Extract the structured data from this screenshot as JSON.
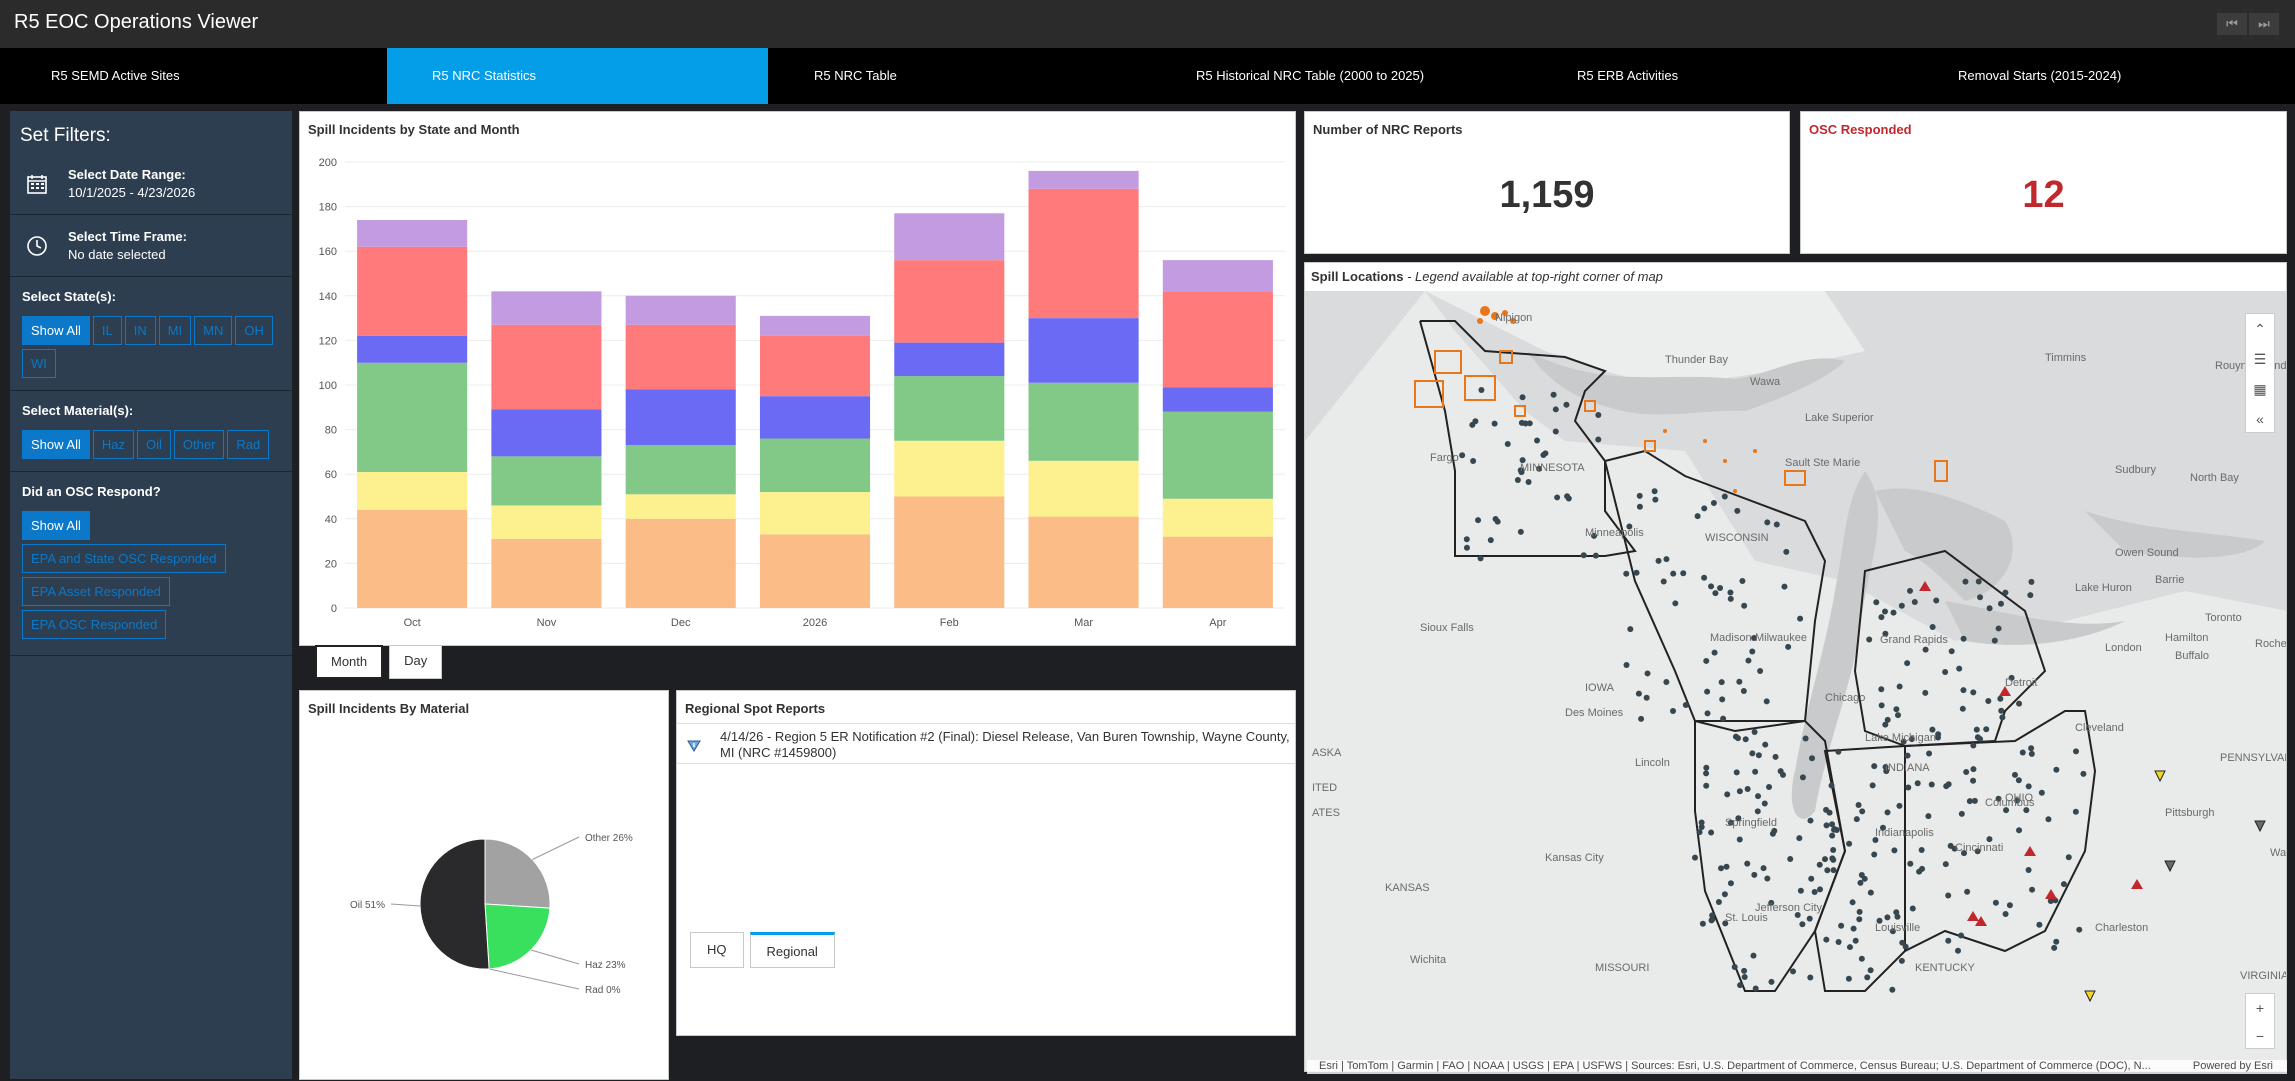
{
  "app": {
    "title": "R5 EOC Operations Viewer",
    "nav_prev_icon": "⏮",
    "nav_next_icon": "⏭"
  },
  "tabs": [
    {
      "label": "R5 SEMD Active Sites"
    },
    {
      "label": "R5 NRC Statistics"
    },
    {
      "label": "R5 NRC Table"
    },
    {
      "label": "R5 Historical NRC Table (2000 to 2025)"
    },
    {
      "label": "R5 ERB Activities"
    },
    {
      "label": "Removal Starts (2015-2024)"
    }
  ],
  "filters": {
    "title": "Set Filters:",
    "date_range_label": "Select Date Range:",
    "date_range_value": "10/1/2025 - 4/23/2026",
    "time_frame_label": "Select Time Frame:",
    "time_frame_value": "No date selected",
    "states_label": "Select State(s):",
    "states": [
      "Show All",
      "IL",
      "IN",
      "MI",
      "MN",
      "OH",
      "WI"
    ],
    "materials_label": "Select Material(s):",
    "materials": [
      "Show All",
      "Haz",
      "Oil",
      "Other",
      "Rad"
    ],
    "osc_label": "Did an OSC Respond?",
    "osc_options": [
      "Show All",
      "EPA and State OSC Responded",
      "EPA Asset Responded",
      "EPA OSC Responded"
    ]
  },
  "kpis": {
    "nrc_reports_label": "Number of NRC Reports",
    "nrc_reports_value": "1,159",
    "osc_responded_label": "OSC Responded",
    "osc_responded_value": "12",
    "osc_color": "#c0282d"
  },
  "bar_chart": {
    "title": "Spill Incidents by State and Month",
    "toggle": [
      "Month",
      "Day"
    ]
  },
  "chart_data": [
    {
      "type": "bar",
      "stacked": true,
      "title": "Spill Incidents by State and Month",
      "categories": [
        "Oct",
        "Nov",
        "Dec",
        "2026",
        "Feb",
        "Mar",
        "Apr"
      ],
      "ylim": [
        0,
        200
      ],
      "yticks": [
        0,
        20,
        40,
        60,
        80,
        100,
        120,
        140,
        160,
        180,
        200
      ],
      "series": [
        {
          "color": "#fbbc88",
          "values": [
            44,
            31,
            40,
            33,
            50,
            41,
            32
          ]
        },
        {
          "color": "#fdf08f",
          "values": [
            17,
            15,
            11,
            19,
            25,
            25,
            17
          ]
        },
        {
          "color": "#82c886",
          "values": [
            49,
            22,
            22,
            24,
            29,
            35,
            39
          ]
        },
        {
          "color": "#6a6af4",
          "values": [
            12,
            21,
            25,
            19,
            15,
            29,
            11
          ]
        },
        {
          "color": "#ff7b7b",
          "values": [
            40,
            38,
            29,
            27,
            37,
            58,
            43
          ]
        },
        {
          "color": "#c39be0",
          "values": [
            12,
            15,
            13,
            9,
            21,
            8,
            14
          ]
        }
      ]
    },
    {
      "type": "pie",
      "title": "Spill Incidents By Material",
      "slices": [
        {
          "label": "Other 26%",
          "value": 26,
          "color": "#a2a2a2"
        },
        {
          "label": "Haz 23%",
          "value": 23,
          "color": "#38e05e"
        },
        {
          "label": "Rad 0%",
          "value": 0,
          "color": "#c39be0"
        },
        {
          "label": "Oil 51%",
          "value": 51,
          "color": "#2a2a2c"
        }
      ]
    }
  ],
  "spot_reports": {
    "title": "Regional Spot Reports",
    "items": [
      {
        "text": "4/14/26 - Region 5 ER Notification #2 (Final): Diesel Release, Van Buren Township, Wayne County, MI (NRC #1459800)"
      }
    ],
    "tabs": [
      "HQ",
      "Regional"
    ]
  },
  "map": {
    "title": "Spill Locations",
    "subtitle": " - Legend available at top-right corner of map",
    "labels": [
      "Nipigon",
      "Thunder Bay",
      "Timmins",
      "Rouyn-Noranda",
      "Wawa",
      "Lake Superior",
      "Fargo",
      "MINNESOTA",
      "Sault Ste Marie",
      "Sudbury",
      "North Bay",
      "Minneapolis",
      "WISCONSIN",
      "Owen Sound",
      "Barrie",
      "Lake Huron",
      "Sioux Falls",
      "Madison",
      "Milwaukee",
      "Grand Rapids",
      "Toronto",
      "Hamilton",
      "Rochester",
      "London",
      "Buffalo",
      "IOWA",
      "Des Moines",
      "Chicago",
      "Detroit",
      "Lake Michigan",
      "Cleveland",
      "Lincoln",
      "INDIANA",
      "OHIO",
      "PENNSYLVANIA",
      "Pittsburgh",
      "Springfield",
      "Indianapolis",
      "Columbus",
      "Kansas City",
      "Cincinnati",
      "KANSAS",
      "Jefferson City",
      "St. Louis",
      "Louisville",
      "Charleston",
      "Wichita",
      "MISSOURI",
      "KENTUCKY",
      "VIRGINIA",
      "ITED",
      "ATES",
      "ASKA",
      "Was"
    ],
    "attribution": "Esri | TomTom | Garmin | FAO | NOAA | USGS | EPA | USFWS | Sources: Esri, U.S. Department of Commerce, Census Bureau; U.S. Department of Commerce (DOC), N...",
    "powered_by": "Powered by Esri"
  }
}
